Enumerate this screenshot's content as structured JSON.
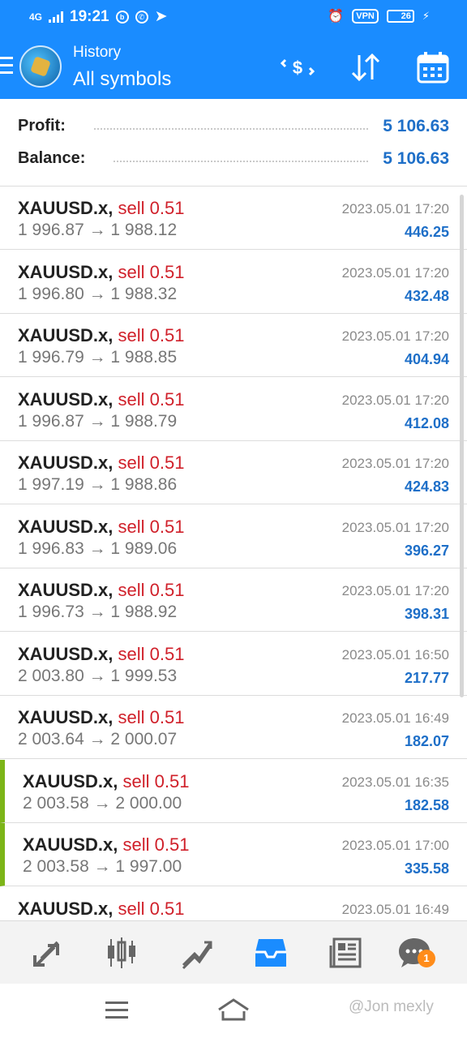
{
  "status_bar": {
    "network": "4G",
    "time": "19:21",
    "vpn": "VPN",
    "battery": "26"
  },
  "app_bar": {
    "title": "History",
    "subtitle": "All symbols"
  },
  "summary": {
    "profit_label": "Profit:",
    "profit_value": "5 106.63",
    "balance_label": "Balance:",
    "balance_value": "5 106.63"
  },
  "deals": [
    {
      "symbol": "XAUUSD.x,",
      "side": "sell 0.51",
      "prices": "1 996.87 → 1 988.12",
      "time": "2023.05.01 17:20",
      "profit": "446.25",
      "marked": false
    },
    {
      "symbol": "XAUUSD.x,",
      "side": "sell 0.51",
      "prices": "1 996.80 → 1 988.32",
      "time": "2023.05.01 17:20",
      "profit": "432.48",
      "marked": false
    },
    {
      "symbol": "XAUUSD.x,",
      "side": "sell 0.51",
      "prices": "1 996.79 → 1 988.85",
      "time": "2023.05.01 17:20",
      "profit": "404.94",
      "marked": false
    },
    {
      "symbol": "XAUUSD.x,",
      "side": "sell 0.51",
      "prices": "1 996.87 → 1 988.79",
      "time": "2023.05.01 17:20",
      "profit": "412.08",
      "marked": false
    },
    {
      "symbol": "XAUUSD.x,",
      "side": "sell 0.51",
      "prices": "1 997.19 → 1 988.86",
      "time": "2023.05.01 17:20",
      "profit": "424.83",
      "marked": false
    },
    {
      "symbol": "XAUUSD.x,",
      "side": "sell 0.51",
      "prices": "1 996.83 → 1 989.06",
      "time": "2023.05.01 17:20",
      "profit": "396.27",
      "marked": false
    },
    {
      "symbol": "XAUUSD.x,",
      "side": "sell 0.51",
      "prices": "1 996.73 → 1 988.92",
      "time": "2023.05.01 17:20",
      "profit": "398.31",
      "marked": false
    },
    {
      "symbol": "XAUUSD.x,",
      "side": "sell 0.51",
      "prices": "2 003.80 → 1 999.53",
      "time": "2023.05.01 16:50",
      "profit": "217.77",
      "marked": false
    },
    {
      "symbol": "XAUUSD.x,",
      "side": "sell 0.51",
      "prices": "2 003.64 → 2 000.07",
      "time": "2023.05.01 16:49",
      "profit": "182.07",
      "marked": false
    },
    {
      "symbol": "XAUUSD.x,",
      "side": "sell 0.51",
      "prices": "2 003.58 → 2 000.00",
      "time": "2023.05.01 16:35",
      "profit": "182.58",
      "marked": true
    },
    {
      "symbol": "XAUUSD.x,",
      "side": "sell 0.51",
      "prices": "2 003.58 → 1 997.00",
      "time": "2023.05.01 17:00",
      "profit": "335.58",
      "marked": true
    },
    {
      "symbol": "XAUUSD.x,",
      "side": "sell 0.51",
      "prices": "",
      "time": "2023.05.01 16:49",
      "profit": "",
      "marked": false
    }
  ],
  "bottom_nav": {
    "items": [
      "quotes-icon",
      "chart-icon",
      "trade-icon",
      "history-icon",
      "news-icon",
      "chat-icon"
    ],
    "active": "history-icon",
    "chat_badge": "1"
  },
  "watermark": "@Jon mexly",
  "colors": {
    "header_bg": "#1a8cff",
    "accent_blue": "#1e6fc8",
    "sell_red": "#d0202a",
    "marker_green": "#7cb518"
  }
}
